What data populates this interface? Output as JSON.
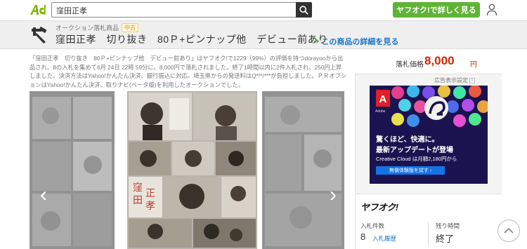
{
  "header": {
    "search_value": "窪田正孝",
    "yahoo_button": "ヤフオク!で詳しく見る"
  },
  "titlebar": {
    "category": "オークション落札商品",
    "badge": "中古",
    "title": "窪田正孝　切り抜き　80Ｐ+ピンナップ他　デビュー前あり",
    "detail_link": "この商品の詳細を見る",
    "detail_arrow": "➔"
  },
  "description": "「窪田正孝　切り抜き　80Ｐ+ピンナップ他　デビュー前あり」はヤフオク!で1229（99%）の評価を持つdorayooから出品され、8の入札を集めて6月 24日 22時 59分に、8,000円で落札されました。終了1時間以内に2件入札され、250円上昇しました。決済方法はYahoo!かんたん決済、銀行振込に対応。埼玉県からの発送料はQ*!*/***が負担しました。ＰＲオプションはYahoo!かんたん決済、取りナビ(ベータ版)を利用したオークションでした。",
  "carousel": {
    "prev": "‹",
    "next": "›"
  },
  "price": {
    "label": "落札価格",
    "value": "8,000",
    "unit": "円"
  },
  "ad": {
    "label": "広告表示設定",
    "close": "×",
    "line1": "驚くほど、快適に。",
    "line2": "最新アップデートが登場",
    "line3": "Creative Cloud は月額2,180円から",
    "cta": "無償体験版を試す ›",
    "brand_letter": "A",
    "brand_name": "Adobe"
  },
  "auction": {
    "logo": "ヤフオク!",
    "bid_count_label": "入札件数",
    "bid_count": "8",
    "bid_history": "入札履歴",
    "remaining_label": "残り時間",
    "remaining_value": "終了"
  },
  "colors": {
    "accent_green": "#5fb336",
    "price_red": "#d52400",
    "link_blue": "#1a75c9"
  }
}
